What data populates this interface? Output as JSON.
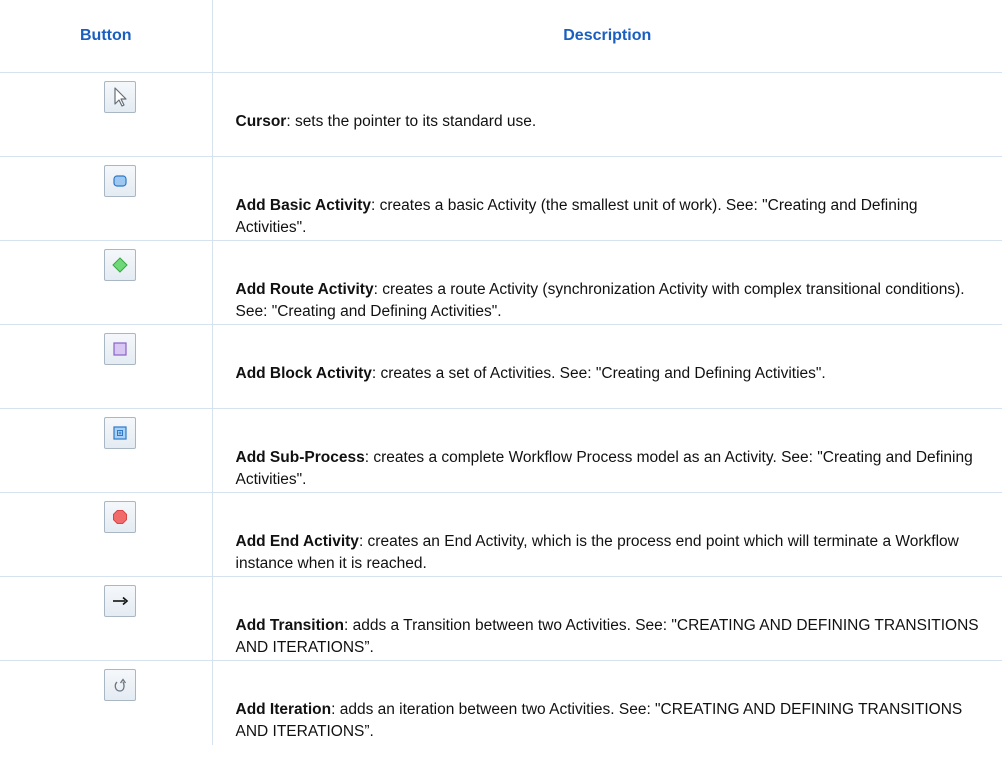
{
  "table": {
    "headers": {
      "button": "Button",
      "description": "Description"
    },
    "rows": [
      {
        "icon": "cursor-icon",
        "term": "Cursor",
        "text": ": sets the pointer to its standard use."
      },
      {
        "icon": "basic-activity-icon",
        "term": "Add Basic Activity",
        "text": ": creates a basic Activity (the smallest unit of work). See: \"Creating and Defining Activities\"."
      },
      {
        "icon": "route-activity-icon",
        "term": "Add Route Activity",
        "text": ": creates a route Activity (synchronization Activity with complex transitional conditions). See: \"Creating and Defining Activities\"."
      },
      {
        "icon": "block-activity-icon",
        "term": "Add Block Activity",
        "text": ": creates a set of Activities. See: \"Creating and Defining Activities\"."
      },
      {
        "icon": "sub-process-icon",
        "term": "Add Sub-Process",
        "text": ": creates a complete Workflow Process model as an Activity. See: \"Creating and Defining Activities\"."
      },
      {
        "icon": "end-activity-icon",
        "term": "Add End Activity",
        "text": ": creates an End Activity, which is the process end point which will terminate a Workflow instance when it is reached."
      },
      {
        "icon": "transition-arrow-icon",
        "term": "Add Transition",
        "text": ": adds a Transition between two Activities. See: \"CREATING AND DEFINING TRANSITIONS AND ITERATIONS”."
      },
      {
        "icon": "iteration-icon",
        "term": "Add Iteration",
        "text": ": adds an iteration between two Activities. See: \"CREATING AND DEFINING TRANSITIONS AND ITERATIONS”."
      }
    ]
  }
}
